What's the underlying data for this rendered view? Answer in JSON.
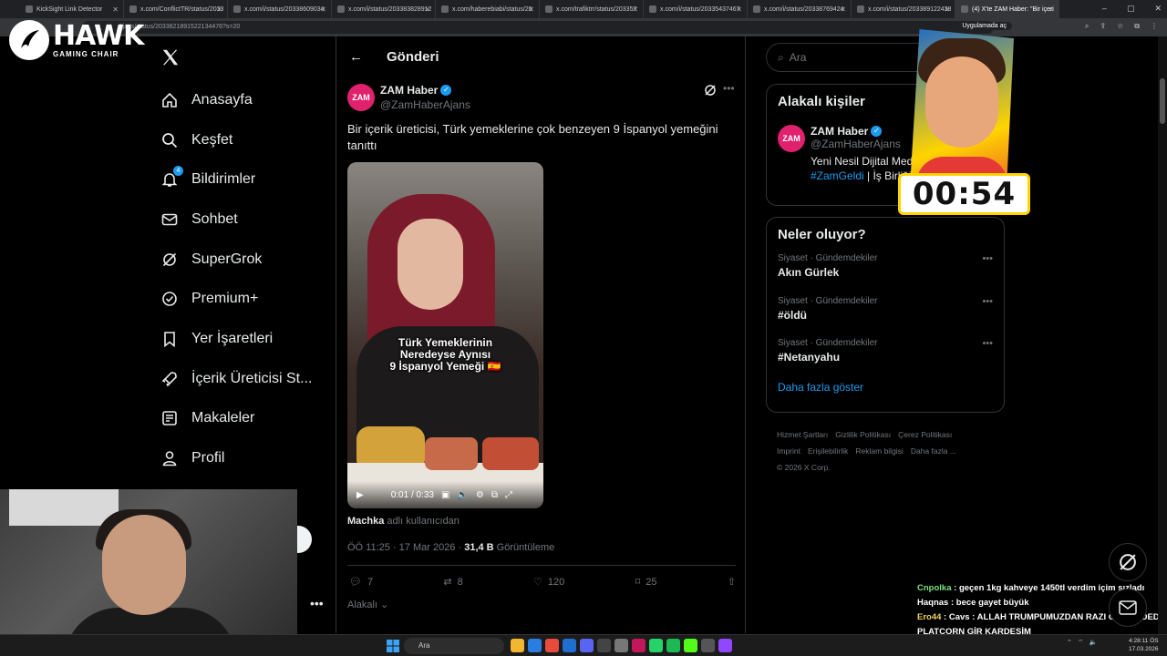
{
  "browser": {
    "tabs": [
      {
        "title": "KickSight Link Detector",
        "active": false
      },
      {
        "title": "x.com/ConflictTR/status/2033",
        "active": false
      },
      {
        "title": "x.com/i/status/20338609034",
        "active": false
      },
      {
        "title": "x.com/i/status/203383828912",
        "active": false
      },
      {
        "title": "x.com/haberebiabi/status/20",
        "active": false
      },
      {
        "title": "x.com/trafiktrr/status/203357",
        "active": false
      },
      {
        "title": "x.com/i/status/20335437467",
        "active": false
      },
      {
        "title": "x.com/i/status/20338769424",
        "active": false
      },
      {
        "title": "x.com/i/status/203389122438",
        "active": false
      },
      {
        "title": "(4) X'te ZAM Haber: \"Bir içeri",
        "active": true
      }
    ],
    "url": "Ajans/status/2033821891522134476?s=20",
    "apps_label": "Uygulamada aç"
  },
  "brand": {
    "name": "HAWK",
    "sub": "GAMING CHAIR"
  },
  "sidebar": {
    "items": [
      {
        "label": "Anasayfa",
        "icon": "home-icon"
      },
      {
        "label": "Keşfet",
        "icon": "search-icon"
      },
      {
        "label": "Bildirimler",
        "icon": "bell-icon",
        "badge": "4"
      },
      {
        "label": "Sohbet",
        "icon": "mail-icon"
      },
      {
        "label": "SuperGrok",
        "icon": "grok-icon"
      },
      {
        "label": "Premium+",
        "icon": "verified-icon"
      },
      {
        "label": "Yer İşaretleri",
        "icon": "bookmark-icon"
      },
      {
        "label": "İçerik Üreticisi St...",
        "icon": "rocket-icon"
      },
      {
        "label": "Makaleler",
        "icon": "article-icon"
      },
      {
        "label": "Profil",
        "icon": "profile-icon"
      }
    ]
  },
  "post": {
    "header": "Gönderi",
    "author_name": "ZAM Haber",
    "author_handle": "@ZamHaberAjans",
    "avatar_text": "ZAM",
    "text": "Bir içerik üreticisi, Türk yemeklerine çok benzeyen 9 İspanyol yemeğini tanıttı",
    "video_overlay_line1": "Türk Yemeklerinin",
    "video_overlay_line2": "Neredeyse Aynısı",
    "video_overlay_line3": "9 İspanyol Yemeği 🇪🇸",
    "video_time": "0:01 / 0:33",
    "credit_user": "Machka",
    "credit_suffix": "adlı kullanıcıdan",
    "time_date": "ÖÖ 11:25 · 17 Mar 2026 · ",
    "views": "31,4 B",
    "views_label": " Görüntüleme",
    "replies": "7",
    "reposts": "8",
    "likes": "120",
    "bookmarks": "25",
    "related": "Alakalı"
  },
  "right": {
    "search_placeholder": "Ara",
    "related_title": "Alakalı kişiler",
    "person_name": "ZAM Haber",
    "person_handle": "@ZamHaberAjans",
    "person_bio": "Yeni Nesil Dijital Medy",
    "person_tag": "#ZamGeldi",
    "person_bio2": " | İş Birliği",
    "trends_title": "Neler oluyor?",
    "trends": [
      {
        "category": "Siyaset · Gündemdekiler",
        "title": "Akın Gürlek"
      },
      {
        "category": "Siyaset · Gündemdekiler",
        "title": "#öldü"
      },
      {
        "category": "Siyaset · Gündemdekiler",
        "title": "#Netanyahu"
      }
    ],
    "show_more": "Daha fazla göster",
    "footer_links": [
      "Hizmet Şartları",
      "Gizlilik Politikası",
      "Çerez Politikası",
      "Imprint",
      "Erişilebilirlik",
      "Reklam bilgisi",
      "Daha fazla ..."
    ],
    "copyright": "© 2026 X Corp."
  },
  "overlay": {
    "timer": "00:54"
  },
  "chat": [
    {
      "user": "Cnpolka",
      "msg": "geçen 1kg kahveye 1450tl verdim içim sızladı"
    },
    {
      "user": "Haqnas",
      "msg": "bece gayet büyük"
    },
    {
      "user": "Ero44",
      "msg": "Cavs : ALLAH TRUMPUMUZDAN RAZI OLSUN DEDI PLATCORN GİR KARDEŞİM"
    }
  ],
  "taskbar": {
    "search": "Ara",
    "time": "4:28:11 ÖS",
    "date": "17.03.2026"
  },
  "colors": {
    "accent": "#1d9bf0",
    "brand_pink": "#e0216e",
    "bg": "#000000"
  }
}
